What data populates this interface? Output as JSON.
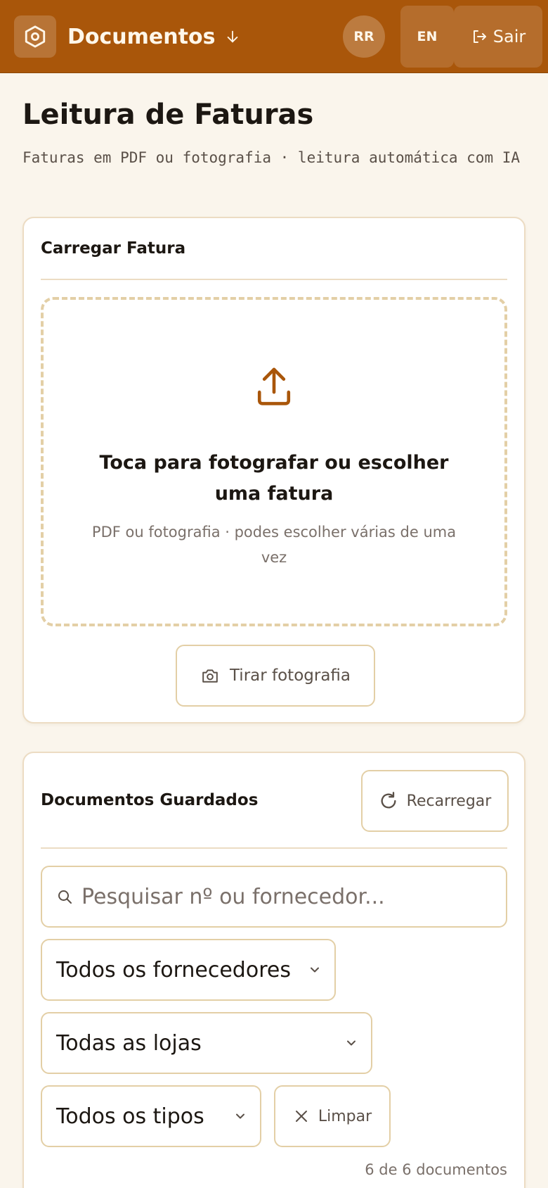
{
  "header": {
    "app_title": "Documentos",
    "avatar_initials": "RR",
    "language_label": "EN",
    "logout_label": "Sair"
  },
  "page": {
    "title": "Leitura de Faturas",
    "subtitle": "Faturas em PDF ou fotografia · leitura automática com IA"
  },
  "upload_card": {
    "title": "Carregar Fatura",
    "drop_title": "Toca para fotografar ou escolher uma fatura",
    "drop_hint": "PDF ou fotografia · podes escolher várias de uma vez",
    "photo_button_label": "Tirar fotografia"
  },
  "documents_card": {
    "title": "Documentos Guardados",
    "reload_label": "Recarregar",
    "search_placeholder": "Pesquisar nº ou fornecedor...",
    "filters": {
      "supplier_selected": "Todos os fornecedores",
      "store_selected": "Todas as lojas",
      "type_selected": "Todos os tipos"
    },
    "clear_label": "Limpar",
    "count_text": "6 de 6 documentos"
  },
  "colors": {
    "brand": "#a9560a",
    "background": "#faf5ec",
    "border": "#e3cfa6"
  },
  "icons": {
    "logo": "hexagon-logo-icon",
    "sort": "arrow-down-icon",
    "logout": "logout-icon",
    "upload": "upload-icon",
    "camera": "camera-icon",
    "reload": "refresh-icon",
    "search": "search-icon",
    "chevron": "chevron-down-icon",
    "clear": "close-icon"
  }
}
